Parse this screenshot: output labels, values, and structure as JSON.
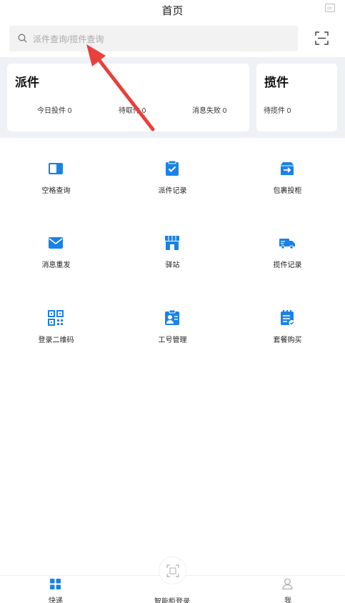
{
  "header": {
    "title": "首页"
  },
  "search": {
    "placeholder": "派件查询/揽件查询"
  },
  "cards": {
    "delivery": {
      "title": "派件",
      "stats": [
        {
          "label": "今日投件 0"
        },
        {
          "label": "待取件 0"
        },
        {
          "label": "消息失败  0"
        }
      ]
    },
    "pickup": {
      "title": "揽件",
      "stats": [
        {
          "label": "待揽件 0"
        }
      ]
    }
  },
  "grid": [
    {
      "label": "空格查询",
      "icon": "door-icon"
    },
    {
      "label": "派件记录",
      "icon": "clipboard-check-icon"
    },
    {
      "label": "包裹投柜",
      "icon": "box-arrow-icon"
    },
    {
      "label": "消息重发",
      "icon": "envelope-icon"
    },
    {
      "label": "驿站",
      "icon": "store-icon"
    },
    {
      "label": "揽件记录",
      "icon": "truck-icon"
    },
    {
      "label": "登录二维码",
      "icon": "qrcode-icon"
    },
    {
      "label": "工号管理",
      "icon": "id-badge-icon"
    },
    {
      "label": "套餐购买",
      "icon": "notepad-check-icon"
    }
  ],
  "tabbar": {
    "tabs": [
      {
        "label": "快递"
      },
      {
        "label": "智能柜登录"
      },
      {
        "label": "我"
      }
    ]
  },
  "colors": {
    "accent": "#1a82e6",
    "annotation_arrow": "#e8403a",
    "stats_bg": "#eef1f6"
  }
}
